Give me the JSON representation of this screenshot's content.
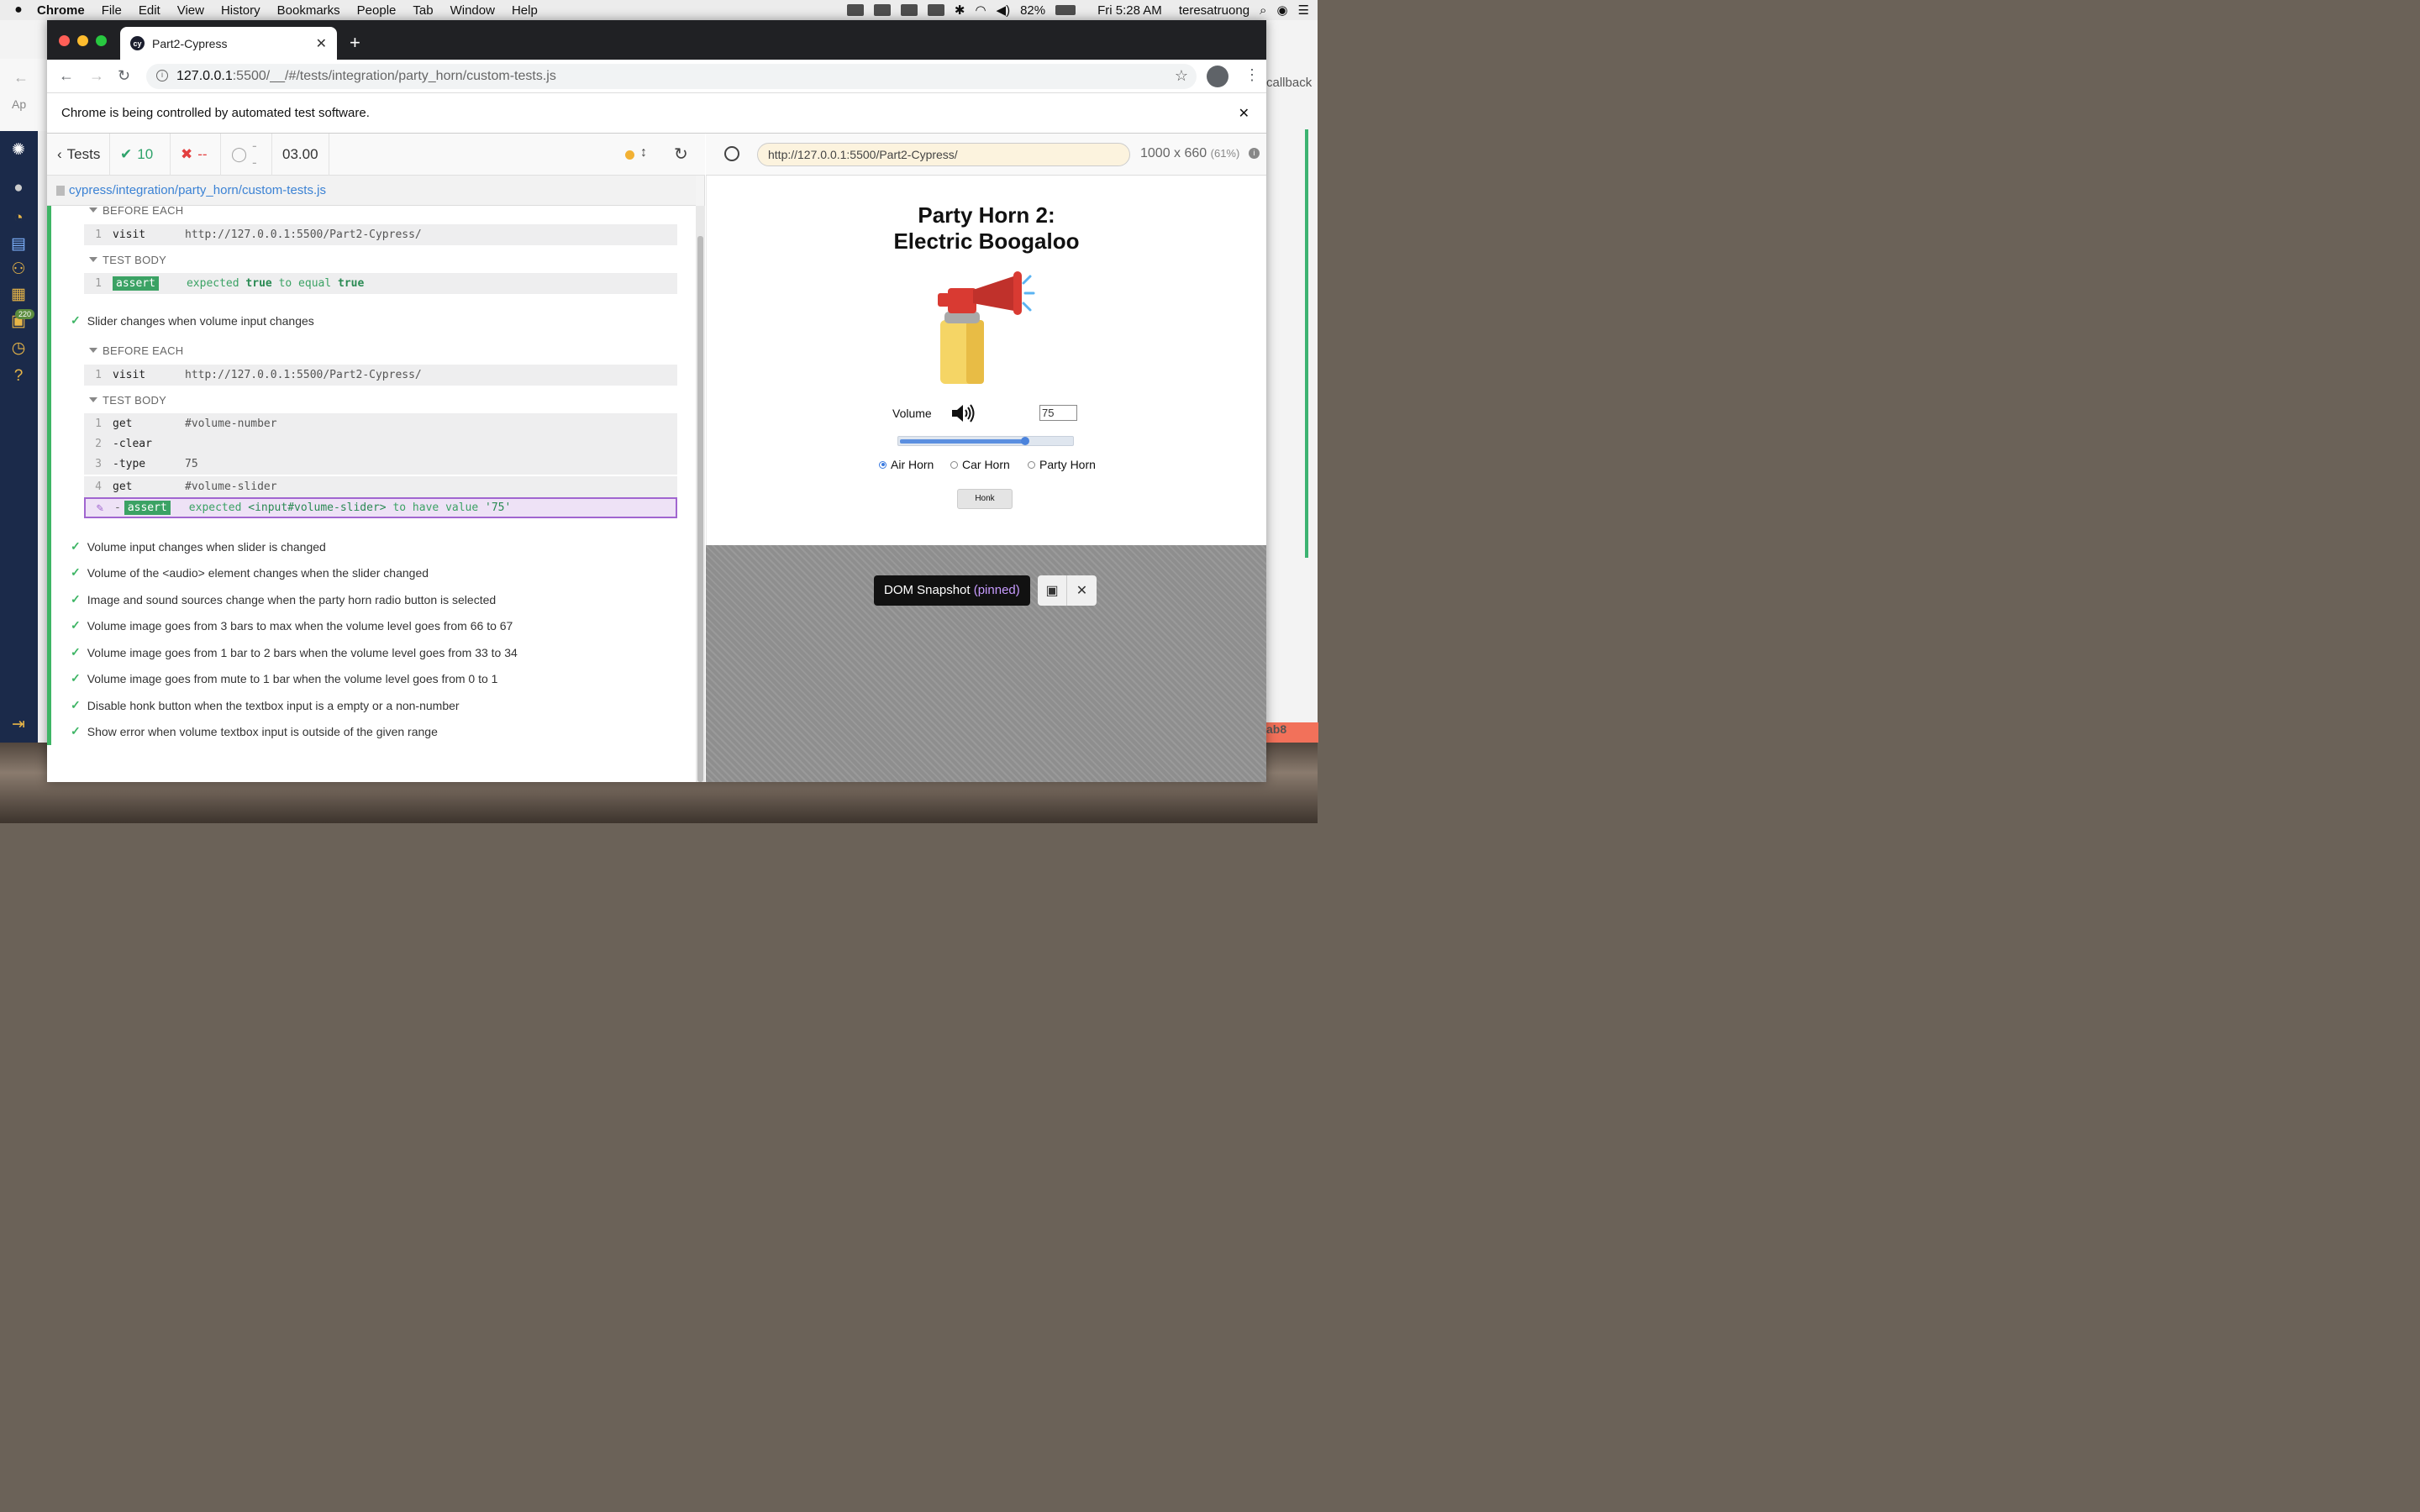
{
  "menubar": {
    "app": "Chrome",
    "items": [
      "File",
      "Edit",
      "View",
      "History",
      "Bookmarks",
      "People",
      "Tab",
      "Window",
      "Help"
    ],
    "battery": "82%",
    "clock": "Fri 5:28 AM",
    "user": "teresatruong"
  },
  "tab": {
    "title": "Part2-Cypress",
    "favicon": "cy"
  },
  "address": {
    "host": "127.0.0.1",
    "rest": ":5500/__/#/tests/integration/party_horn/custom-tests.js"
  },
  "infobar": {
    "text": "Chrome is being controlled by automated test software."
  },
  "sidebar": {
    "badge": "220"
  },
  "bg_right": {
    "text1": "callback",
    "text2": "ab8"
  },
  "bg_left": {
    "text": "Ap"
  },
  "reporter": {
    "tests_label": "Tests",
    "passed": "10",
    "failed": "--",
    "pending": "--",
    "duration": "03.00",
    "spec_path": "cypress/integration/party_horn/custom-tests.js",
    "before_each": "BEFORE EACH",
    "test_body": "TEST BODY",
    "block1": {
      "visit_num": "1",
      "visit_name": "visit",
      "visit_url": "http://127.0.0.1:5500/Part2-Cypress/",
      "assert_num": "1",
      "assert_label": "assert",
      "msg_expected": "expected",
      "msg_true": "true",
      "msg_to_equal": "to equal",
      "msg_true2": "true"
    },
    "test2": {
      "title": "Slider changes when volume input changes",
      "visit_num": "1",
      "visit_name": "visit",
      "visit_url": "http://127.0.0.1:5500/Part2-Cypress/",
      "cmds": [
        {
          "num": "1",
          "name": "get",
          "msg": "#volume-number"
        },
        {
          "num": "2",
          "name": "-clear",
          "msg": ""
        },
        {
          "num": "3",
          "name": "-type",
          "msg": "75"
        },
        {
          "num": "4",
          "name": "get",
          "msg": "#volume-slider"
        }
      ],
      "assert_dash": "-",
      "assert_label": "assert",
      "a_expected": "expected",
      "a_el": "<input#volume-slider>",
      "a_to_have": "to have value",
      "a_val": "'75'"
    },
    "other_tests": [
      "Volume input changes when slider is changed",
      "Volume of the <audio> element changes when the slider changed",
      "Image and sound sources change when the party horn radio button is selected",
      "Volume image goes from 3 bars to max when the volume level goes from 66 to 67",
      "Volume image goes from 1 bar to 2 bars when the volume level goes from 33 to 34",
      "Volume image goes from mute to 1 bar when the volume level goes from 0 to 1",
      "Disable honk button when the textbox input is a empty or a non-number",
      "Show error when volume textbox input is outside of the given range"
    ]
  },
  "aut": {
    "url": "http://127.0.0.1:5500/Part2-Cypress/",
    "dims": "1000 x 660",
    "pct": "(61%)"
  },
  "app": {
    "title1": "Party Horn 2:",
    "title2": "Electric Boogaloo",
    "volume_label": "Volume",
    "volume_value": "75",
    "volume_fraction": 0.75,
    "radios": [
      "Air Horn",
      "Car Horn",
      "Party Horn"
    ],
    "selected_radio": "Air Horn",
    "honk": "Honk"
  },
  "snapshot": {
    "label": "DOM Snapshot",
    "pinned": "(pinned)"
  }
}
